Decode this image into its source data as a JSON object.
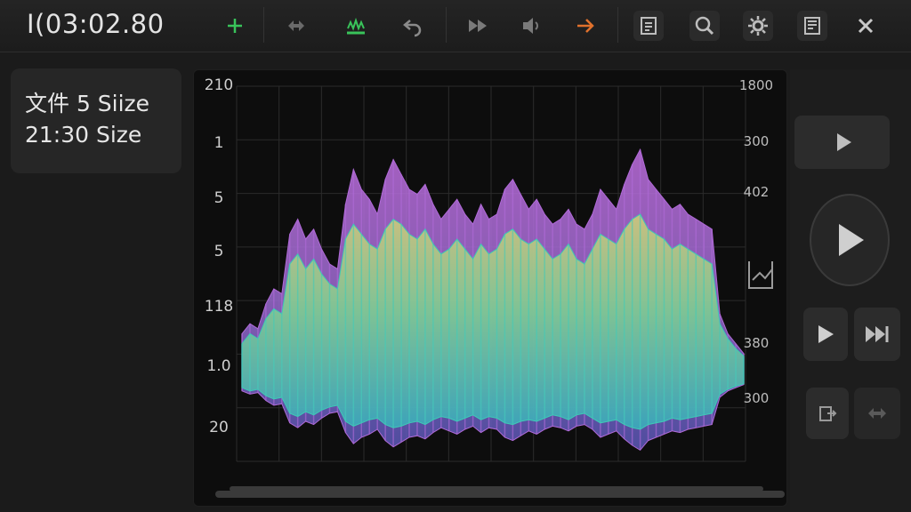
{
  "toolbar": {
    "timecode": "I(03:02.80",
    "icons": [
      "plus-icon",
      "move-icon",
      "waveform-add-icon",
      "undo-icon",
      "fast-forward-icon",
      "volume-icon",
      "arrow-right-icon",
      "file-icon",
      "zoom-icon",
      "settings-icon",
      "notes-icon",
      "close-icon"
    ]
  },
  "info": {
    "file_size": "文件 5 Siize",
    "time_size": "21:30 Size"
  },
  "chart": {
    "left_ticks": [
      "210",
      "1",
      "5",
      "5",
      "118",
      "1.0",
      "20"
    ],
    "right_ticks": [
      "1800",
      "300",
      "402",
      "380",
      "300"
    ]
  },
  "colors": {
    "accent_green": "#39c35a",
    "accent_orange": "#e0712c",
    "wave_purple": "#b06ad8",
    "wave_teal": "#3ec9b6",
    "wave_yellow": "#c9d36a"
  },
  "chart_data": {
    "type": "area",
    "series": [
      {
        "values": [
          12,
          16,
          14,
          24,
          30,
          28,
          52,
          58,
          50,
          54,
          46,
          40,
          38,
          64,
          78,
          70,
          66,
          60,
          74,
          82,
          76,
          70,
          68,
          72,
          64,
          58,
          62,
          66,
          60,
          56,
          64,
          58,
          60,
          70,
          74,
          68,
          62,
          66,
          60,
          56,
          58,
          62,
          56,
          54,
          60,
          70,
          66,
          62,
          72,
          80,
          86,
          74,
          70,
          66,
          62,
          64,
          60,
          58,
          56,
          54,
          20,
          12,
          8,
          4
        ]
      },
      {
        "values": [
          8,
          12,
          10,
          18,
          22,
          20,
          40,
          44,
          38,
          42,
          36,
          32,
          30,
          50,
          56,
          52,
          48,
          46,
          54,
          58,
          56,
          52,
          50,
          54,
          48,
          44,
          46,
          50,
          46,
          42,
          48,
          44,
          46,
          52,
          54,
          50,
          48,
          50,
          46,
          42,
          44,
          48,
          42,
          40,
          46,
          52,
          50,
          48,
          54,
          58,
          60,
          54,
          52,
          50,
          46,
          48,
          46,
          44,
          42,
          40,
          16,
          10,
          6,
          3
        ]
      }
    ]
  }
}
